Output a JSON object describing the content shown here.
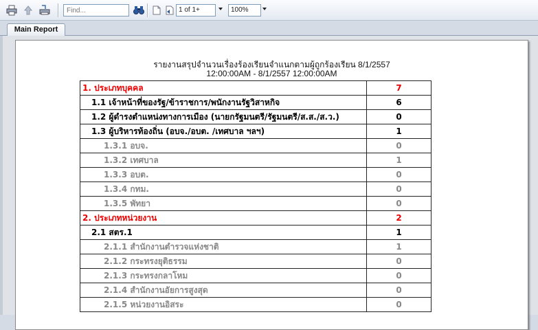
{
  "toolbar": {
    "find_placeholder": "Find...",
    "page_value": "1 of 1+",
    "zoom_value": "100%"
  },
  "tabs": [
    {
      "label": "Main Report"
    }
  ],
  "report": {
    "title_line1": "รายงานสรุปจำนวนเรื่องร้องเรียนจำแนกตามผู้ถูกร้องเรียน 8/1/2557",
    "title_line2": "12:00:00AM - 8/1/2557  12:00:00AM",
    "rows": [
      {
        "label": "1. ประเภทบุคคล",
        "value": "7",
        "level": 0
      },
      {
        "label": "1.1  เจ้าหน้าที่ของรัฐ/ข้าราชการ/พนักงานรัฐวิสาหกิจ",
        "value": "6",
        "level": 1
      },
      {
        "label": "1.2 ผู้ดำรงตำแหน่งทางการเมือง (นายกรัฐมนตรี/รัฐมนตรี/ส.ส./ส.ว.)",
        "value": "0",
        "level": 1
      },
      {
        "label": "1.3 ผู้บริหารท้องถิ่น  (อบจ./อบต. /เทศบาล ฯลฯ)",
        "value": "1",
        "level": 1
      },
      {
        "label": "1.3.1 อบจ.",
        "value": "0",
        "level": 2
      },
      {
        "label": "1.3.2 เทศบาล",
        "value": "1",
        "level": 2
      },
      {
        "label": "1.3.3 อบต.",
        "value": "0",
        "level": 2
      },
      {
        "label": "1.3.4 กทม.",
        "value": "0",
        "level": 2
      },
      {
        "label": "1.3.5 พัทยา",
        "value": "0",
        "level": 2
      },
      {
        "label": "2. ประเภทหน่วยงาน",
        "value": "2",
        "level": 0
      },
      {
        "label": "2.1 สตร.1",
        "value": "1",
        "level": 1
      },
      {
        "label": "2.1.1 สำนักงานตำรวจแห่งชาติ",
        "value": "1",
        "level": 2
      },
      {
        "label": "2.1.2 กระทรงยุติธรรม",
        "value": "0",
        "level": 2
      },
      {
        "label": "2.1.3 กระทรงกลาโหม",
        "value": "0",
        "level": 2
      },
      {
        "label": "2.1.4 สำนักงานอัยการสูงสุด",
        "value": "0",
        "level": 2
      },
      {
        "label": "2.1.5  หน่วยงานอิสระ",
        "value": "0",
        "level": 2
      }
    ]
  }
}
